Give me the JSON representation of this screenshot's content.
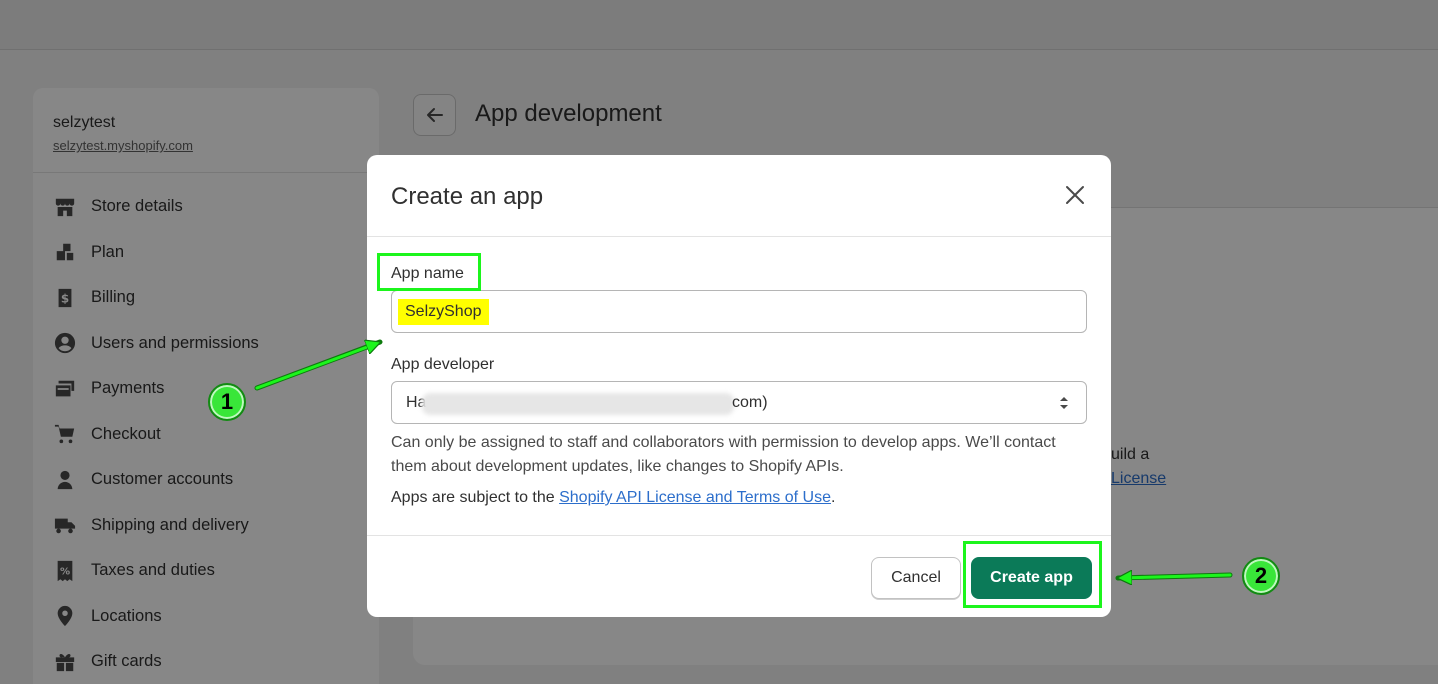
{
  "store": {
    "name": "selzytest",
    "url": "selzytest.myshopify.com"
  },
  "sidebar": {
    "items": [
      {
        "label": "Store details",
        "icon": "store-icon"
      },
      {
        "label": "Plan",
        "icon": "plan-icon"
      },
      {
        "label": "Billing",
        "icon": "billing-icon"
      },
      {
        "label": "Users and permissions",
        "icon": "user-circle-icon"
      },
      {
        "label": "Payments",
        "icon": "payments-icon"
      },
      {
        "label": "Checkout",
        "icon": "cart-icon"
      },
      {
        "label": "Customer accounts",
        "icon": "person-icon"
      },
      {
        "label": "Shipping and delivery",
        "icon": "truck-icon"
      },
      {
        "label": "Taxes and duties",
        "icon": "receipt-icon"
      },
      {
        "label": "Locations",
        "icon": "location-pin-icon"
      },
      {
        "label": "Gift cards",
        "icon": "gift-icon"
      }
    ]
  },
  "page": {
    "title": "App development",
    "card_text_line1": "uild a",
    "card_link": "License"
  },
  "modal": {
    "title": "Create an app",
    "app_name_label": "App name",
    "app_name_value": "SelzyShop",
    "developer_label": "App developer",
    "developer_value_prefix": "Ha",
    "developer_value_suffix": "com)",
    "help_text": "Can only be assigned to staff and collaborators with permission to develop apps. We’ll contact them about development updates, like changes to Shopify APIs.",
    "terms_prefix": "Apps are subject to the ",
    "terms_link": "Shopify API License and Terms of Use",
    "terms_suffix": ".",
    "cancel_label": "Cancel",
    "create_label": "Create app"
  },
  "annotations": {
    "step1": "1",
    "step2": "2",
    "highlight_color": "#1cf51c",
    "input_highlight_color": "#ffff00"
  },
  "colors": {
    "primary_button": "#0b7a58",
    "link": "#2c6ecb"
  }
}
